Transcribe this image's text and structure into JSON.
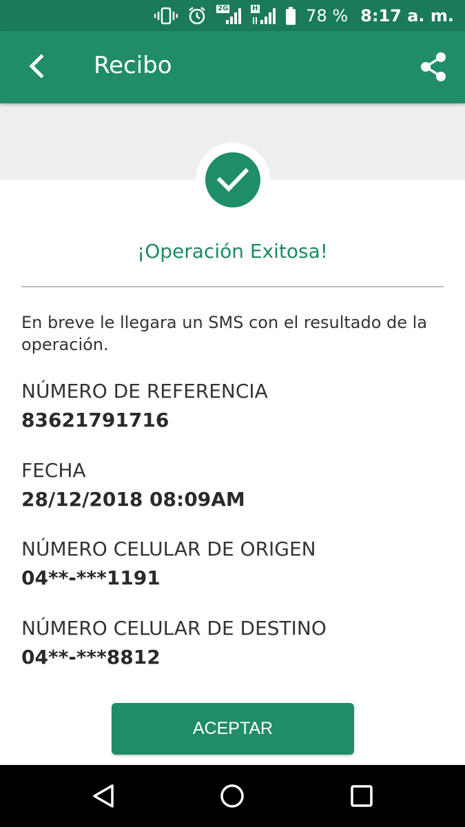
{
  "status_bar": {
    "battery_percent": "78 %",
    "time": "8:17 a. m.",
    "network_2g": "2G",
    "network_h": "H",
    "icons": [
      "vibrate-icon",
      "alarm-icon",
      "signal-icon",
      "battery-icon"
    ]
  },
  "app_bar": {
    "title": "Recibo",
    "back_icon": "chevron-left-icon",
    "share_icon": "share-icon"
  },
  "receipt": {
    "status_icon": "check-icon",
    "success_title": "¡Operación Exitosa!",
    "message": "En breve le llegara un SMS con el resultado de la operación.",
    "fields": [
      {
        "label": "NÚMERO DE REFERENCIA",
        "value": "83621791716"
      },
      {
        "label": "FECHA",
        "value": "28/12/2018 08:09AM"
      },
      {
        "label": "NÚMERO CELULAR DE ORIGEN",
        "value": "04**-***1191"
      },
      {
        "label": "NÚMERO CELULAR DE DESTINO",
        "value": "04**-***8812"
      }
    ]
  },
  "actions": {
    "accept_label": "ACEPTAR"
  },
  "colors": {
    "status_bar": "#1b7a57",
    "primary": "#208d68",
    "accent_text": "#1b8a63",
    "band": "#eeeeee"
  }
}
